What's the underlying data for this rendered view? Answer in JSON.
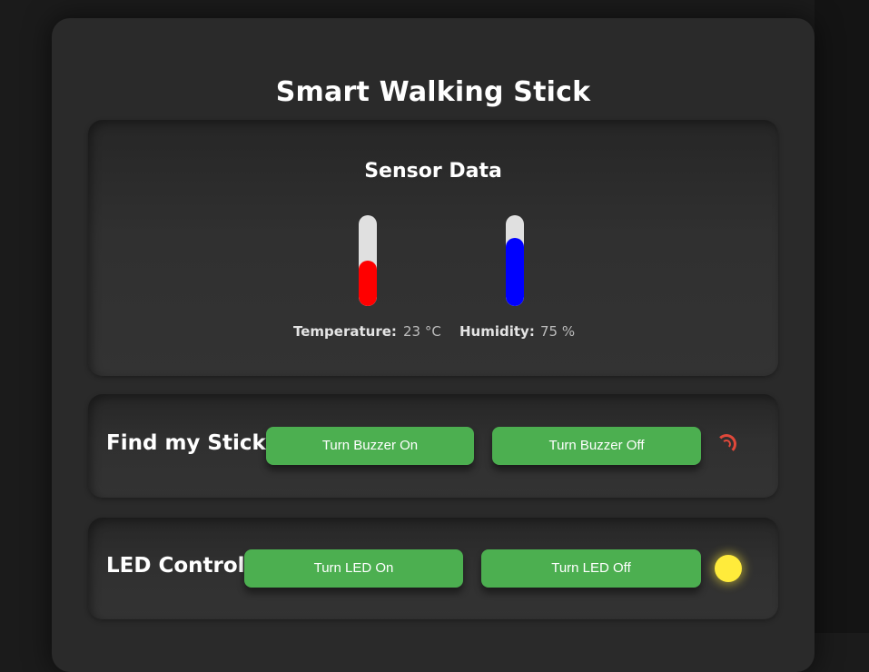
{
  "page": {
    "title": "Smart Walking Stick"
  },
  "sensor": {
    "heading": "Sensor Data",
    "temperature": {
      "label": "Temperature:",
      "value": "23 °C",
      "level": 0.5,
      "color": "#ff0000"
    },
    "humidity": {
      "label": "Humidity:",
      "value": "75 %",
      "level": 0.75,
      "color": "#0000ff"
    }
  },
  "find_stick": {
    "label": "Find my Stick",
    "buzzer_on_label": "Turn Buzzer On",
    "buzzer_off_label": "Turn Buzzer Off",
    "indicator_icon": "spinner-icon",
    "indicator_color": "#e0483a"
  },
  "led_control": {
    "label": "LED Control",
    "led_on_label": "Turn LED On",
    "led_off_label": "Turn LED Off",
    "indicator_icon": "led-indicator-icon",
    "indicator_color": "#ffeb3b"
  },
  "colors": {
    "button": "#4caf50",
    "background": "#1b1b1b",
    "card": "#2a2a2a"
  }
}
